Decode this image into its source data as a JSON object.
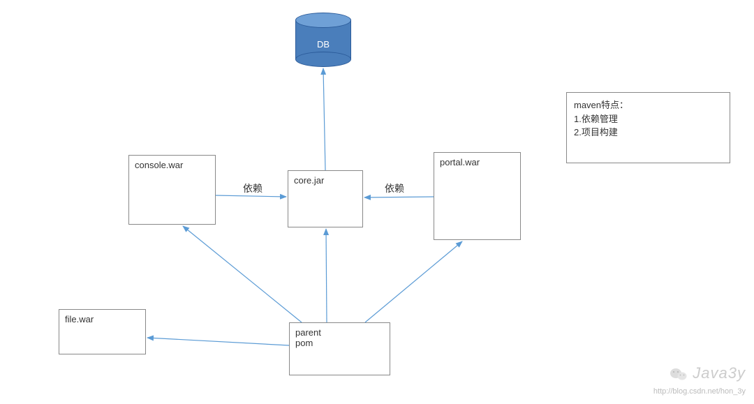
{
  "nodes": {
    "db": {
      "label": "DB"
    },
    "console": {
      "label": "console.war"
    },
    "core": {
      "label": "core.jar"
    },
    "portal": {
      "label": "portal.war"
    },
    "file": {
      "label": "file.war"
    },
    "parent": {
      "label_line1": "parent",
      "label_line2": "pom"
    }
  },
  "edgeLabels": {
    "console_core": "依赖",
    "portal_core": "依赖"
  },
  "note": {
    "title": "maven特点：",
    "line1": "1.依赖管理",
    "line2": "2.项目构建"
  },
  "watermark": {
    "brand": "Java3y",
    "url": "http://blog.csdn.net/hon_3y"
  }
}
